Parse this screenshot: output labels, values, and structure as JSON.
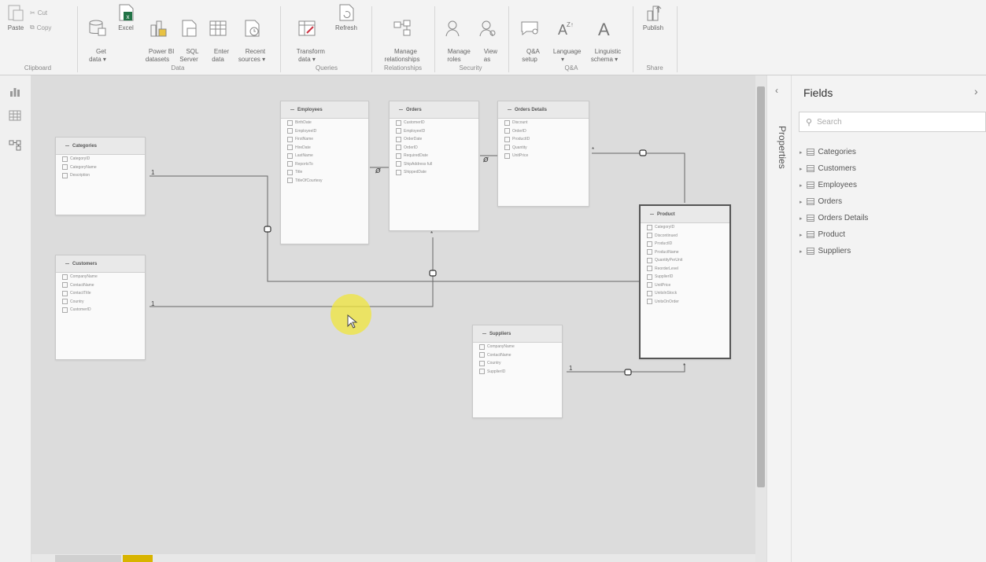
{
  "ribbon": {
    "clipboard": {
      "paste": "Paste",
      "cut": "Cut",
      "copy": "Copy",
      "group": "Clipboard"
    },
    "data": {
      "get_data": "Get\ndata ▾",
      "excel": "Excel",
      "powerbi": "Power BI\ndatasets",
      "sql": "SQL\nServer",
      "enter": "Enter\ndata",
      "recent": "Recent\nsources ▾",
      "group": "Data"
    },
    "queries": {
      "transform": "Transform\ndata ▾",
      "refresh": "Refresh",
      "group": "Queries"
    },
    "relationships": {
      "manage": "Manage\nrelationships",
      "group": "Relationships"
    },
    "security": {
      "roles": "Manage\nroles",
      "view_as": "View\nas",
      "group": "Security"
    },
    "qa": {
      "setup": "Q&A\nsetup",
      "language": "Language\n▾",
      "schema": "Linguistic\nschema ▾",
      "group": "Q&A"
    },
    "share": {
      "publish": "Publish",
      "group": "Share"
    }
  },
  "properties_label": "Properties",
  "fields_panel": {
    "title": "Fields",
    "search_placeholder": "Search",
    "items": [
      "Categories",
      "Customers",
      "Employees",
      "Orders",
      "Orders Details",
      "Product",
      "Suppliers"
    ]
  },
  "tables": {
    "employees": {
      "title": "Employees",
      "fields": [
        "BirthDate",
        "EmployeeID",
        "FirstName",
        "HireDate",
        "LastName",
        "ReportsTo",
        "Title",
        "TitleOfCourtesy"
      ]
    },
    "orders": {
      "title": "Orders",
      "fields": [
        "CustomerID",
        "EmployeeID",
        "OrderDate",
        "OrderID",
        "RequiredDate",
        "ShipAddress full",
        "ShippedDate"
      ]
    },
    "order_details": {
      "title": "Orders Details",
      "fields": [
        "Discount",
        "OrderID",
        "ProductID",
        "Quantity",
        "UnitPrice"
      ]
    },
    "categories": {
      "title": "Categories",
      "fields": [
        "CategoryID",
        "CategoryName",
        "Description"
      ]
    },
    "customers": {
      "title": "Customers",
      "fields": [
        "CompanyName",
        "ContactName",
        "ContactTitle",
        "Country",
        "CustomerID"
      ]
    },
    "product": {
      "title": "Product",
      "fields": [
        "CategoryID",
        "Discontinued",
        "ProductID",
        "ProductName",
        "QuantityPerUnit",
        "ReorderLevel",
        "SupplierID",
        "UnitPrice",
        "UnitsInStock",
        "UnitsOnOrder"
      ]
    },
    "suppliers": {
      "title": "Suppliers",
      "fields": [
        "CompanyName",
        "ContactName",
        "Country",
        "SupplierID"
      ]
    }
  },
  "cardinality": {
    "one": "1",
    "many": "*"
  },
  "colors": {
    "highlight": "#f0e63c",
    "ribbon": "#f3f3f3",
    "canvas": "#dcdcdc"
  }
}
